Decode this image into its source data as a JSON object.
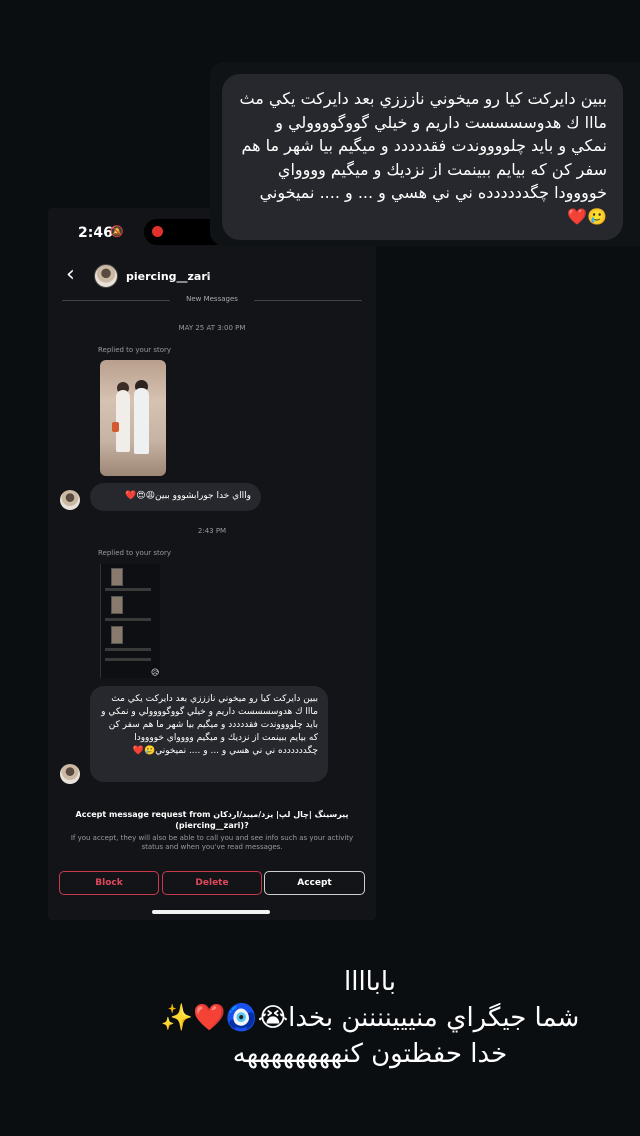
{
  "status_bar": {
    "time": "2:46",
    "bell_off_icon": "bell-slash-icon"
  },
  "zoomed_quote": {
    "text": "ببين دايركت كيا رو ميخوني نازززي بعد دايركت يكي مث مااا ك هدوسسسست داريم و خيلي گووگوووولي و نمكي و بايد چلووووندت فقددددد و ميگيم بيا شهر ما هم سفر كن كه بيايم ببينمت از نزديك و ميگيم وووواي خوووودا چگدددددده ني ني هسي  و ... و .... نميخوني 🥲❤️"
  },
  "chat": {
    "username": "piercing__zari",
    "new_messages_label": "New Messages",
    "timestamp_1": "MAY 25 AT 3:00 PM",
    "replied_label_1": "Replied to your story",
    "message_1": "واااي خدا جورابشووو ببين😩😍❤️",
    "timestamp_2": "2:43 PM",
    "replied_label_2": "Replied to your story",
    "message_2": "ببين دايركت كيا رو ميخوني نازززي بعد دايركت يكي مث مااا ك هدوسسسست داريم و خيلي گووگوووولي و نمكي و بايد چلووووندت فقددددد و ميگيم بيا شهر ما هم سفر كن كه بيايم ببينمت از نزديك و ميگيم وووواي خوووودا چگدددددده ني ني هسي  و ... و .... نميخوني🥲❤️"
  },
  "request": {
    "title_line_1": "Accept message request from پیرسینگ |چال لپ| یزد/میبد/اردکان",
    "title_line_2": "(piercing__zari)?",
    "subtitle": "If you accept, they will also be able to call you and see info such as your activity status and when you've read messages.",
    "block_label": "Block",
    "delete_label": "Delete",
    "accept_label": "Accept"
  },
  "caption": {
    "line_1": "باباااا",
    "line_2": "شما جيگراي منيييننننن بخدا😭🧿❤️✨",
    "line_3": "خدا حفظتون كنههههههههه"
  },
  "colors": {
    "background": "#0b0e11",
    "bubble": "#26282d",
    "danger": "#e0485d",
    "recording_dot": "#e2312c"
  }
}
